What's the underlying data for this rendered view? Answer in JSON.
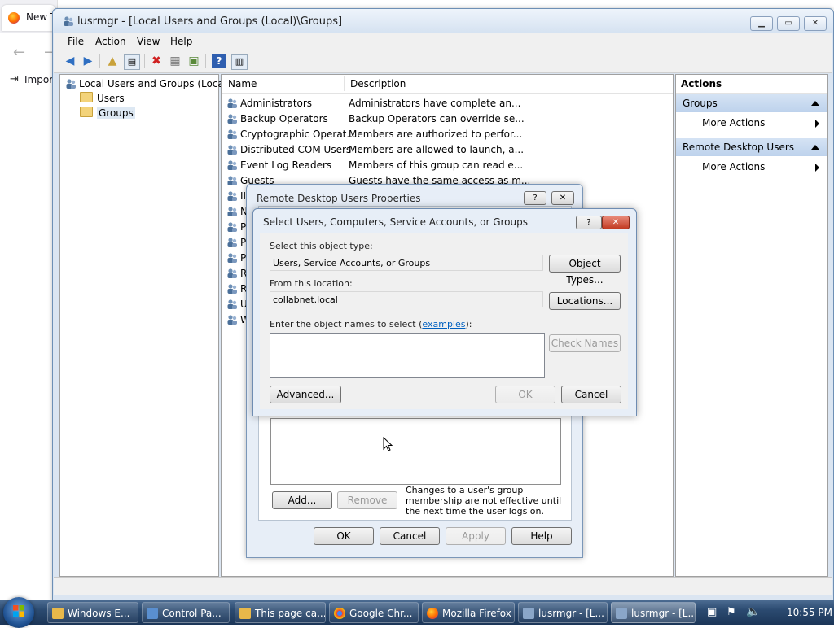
{
  "firefox": {
    "tab_label": "New T",
    "bookmark_label": "Impor"
  },
  "window": {
    "title": "lusrmgr - [Local Users and Groups (Local)\\Groups]",
    "menu": [
      "File",
      "Action",
      "View",
      "Help"
    ]
  },
  "tree": {
    "root": "Local Users and Groups (Local)",
    "children": [
      "Users",
      "Groups"
    ]
  },
  "list": {
    "columns": [
      "Name",
      "Description"
    ],
    "rows": [
      {
        "name": "Administrators",
        "desc": "Administrators have complete an..."
      },
      {
        "name": "Backup Operators",
        "desc": "Backup Operators can override se..."
      },
      {
        "name": "Cryptographic Operat...",
        "desc": "Members are authorized to perfor..."
      },
      {
        "name": "Distributed COM Users",
        "desc": "Members are allowed to launch, a..."
      },
      {
        "name": "Event Log Readers",
        "desc": "Members of this group can read e..."
      },
      {
        "name": "Guests",
        "desc": "Guests have the same access as m..."
      }
    ],
    "hidden_rows": [
      "II",
      "N",
      "P",
      "P",
      "P",
      "R",
      "R",
      "U",
      "W"
    ]
  },
  "actions": {
    "header": "Actions",
    "sections": [
      {
        "title": "Groups",
        "item": "More Actions"
      },
      {
        "title": "Remote Desktop Users",
        "item": "More Actions"
      }
    ]
  },
  "props_dialog": {
    "title": "Remote Desktop Users Properties",
    "add": "Add...",
    "remove": "Remove",
    "note": "Changes to a user's group membership are not effective until the next time the user logs on.",
    "ok": "OK",
    "cancel": "Cancel",
    "apply": "Apply",
    "help": "Help",
    "help_icon": "?",
    "close_icon": "✕"
  },
  "select_dialog": {
    "title": "Select Users, Computers, Service Accounts, or Groups",
    "object_type_label": "Select this object type:",
    "object_type_value": "Users, Service Accounts, or Groups",
    "object_types_button": "Object Types...",
    "location_label": "From this location:",
    "location_value": "collabnet.local",
    "locations_button": "Locations...",
    "names_label": "Enter the object names to select (",
    "names_link": "examples",
    "names_label_end": "):",
    "check_names": "Check Names",
    "advanced": "Advanced...",
    "ok": "OK",
    "cancel": "Cancel"
  },
  "taskbar": {
    "buttons": [
      {
        "label": "Windows E...",
        "color": "#e8b84a"
      },
      {
        "label": "Control Pa...",
        "color": "#5a8fd0"
      },
      {
        "label": "This page ca...",
        "color": "#e8b84a"
      },
      {
        "label": "Google Chr...",
        "color": "#3aa757"
      },
      {
        "label": "Mozilla Firefox",
        "color": "#ff7a1a"
      },
      {
        "label": "lusrmgr - [L...",
        "color": "#8aa6c8"
      },
      {
        "label": "lusrmgr - [L...",
        "color": "#8aa6c8"
      }
    ],
    "clock": "10:55 PM"
  }
}
